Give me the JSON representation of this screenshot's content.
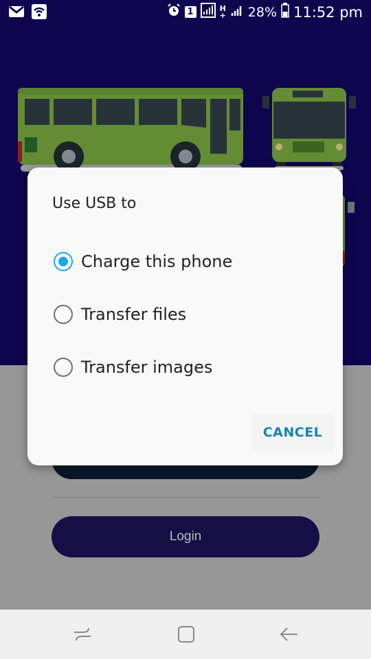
{
  "status_bar": {
    "left_icons": [
      "gmail-icon",
      "wifi-icon"
    ],
    "right": {
      "alarm_icon": "alarm-icon",
      "sim_badge": "1",
      "signal_icons": [
        "sim-signal-icon",
        "hplus-icon",
        "signal-bars-icon"
      ],
      "battery_percent": "28%",
      "time": "11:52 pm"
    }
  },
  "dialog": {
    "title": "Use USB to",
    "options": [
      {
        "label": "Charge this phone",
        "selected": true
      },
      {
        "label": "Transfer files",
        "selected": false
      },
      {
        "label": "Transfer images",
        "selected": false
      }
    ],
    "cancel_label": "CANCEL"
  },
  "login_button": {
    "label": "Login"
  },
  "nav_bar": {
    "icons": [
      "recent-apps-icon",
      "home-icon",
      "back-icon"
    ]
  },
  "colors": {
    "hero_bg": "#14086e",
    "bus_green": "#8bc34a",
    "accent_blue": "#1aa8e4",
    "cancel_text": "#1684b8",
    "login_bg": "#1f1660"
  }
}
